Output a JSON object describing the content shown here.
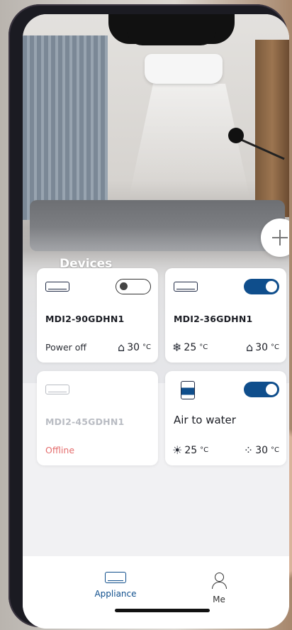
{
  "header": {
    "title": "Devices",
    "add_label": "+"
  },
  "devices": [
    {
      "model": "MDI2-90GDHN1",
      "toggle": "off",
      "status": "Power off",
      "indoor_temp": "30",
      "unit": "°C"
    },
    {
      "model": "MDI2-36GDHN1",
      "toggle": "on",
      "set_temp": "25",
      "indoor_temp": "30",
      "unit": "°C"
    },
    {
      "model": "MDI2-45GDHN1",
      "status": "Offline"
    },
    {
      "name": "Air to water",
      "toggle": "on",
      "heat_temp": "25",
      "water_temp": "30",
      "unit": "°C"
    }
  ],
  "tabs": [
    {
      "label": "Appliance",
      "active": true
    },
    {
      "label": "Me",
      "active": false
    }
  ],
  "colors": {
    "accent": "#0f4e8c",
    "offline": "#e46d6d",
    "card_bg": "#ffffff"
  }
}
